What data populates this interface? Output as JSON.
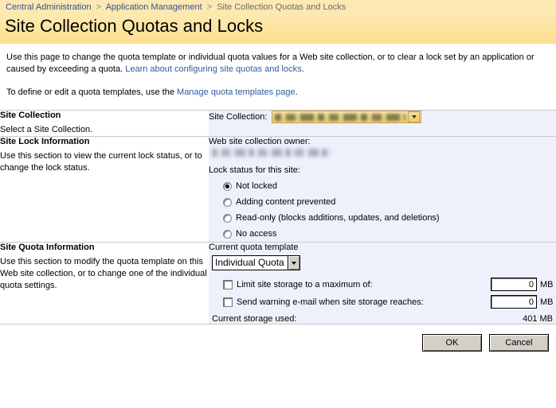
{
  "header": {
    "breadcrumb": [
      {
        "label": "Central Administration",
        "type": "link"
      },
      {
        "label": "Application Management",
        "type": "link"
      },
      {
        "label": "Site Collection Quotas and Locks",
        "type": "current"
      }
    ],
    "separator": ">",
    "title": "Site Collection Quotas and Locks",
    "band_color": "#fde49f"
  },
  "intro": {
    "paragraph1_before": "Use this page to change the quota template or individual quota values for a Web site collection, or to clear a lock set by an application or caused by exceeding a quota. ",
    "paragraph1_link": "Learn about configuring site quotas and locks",
    "paragraph1_after": ".",
    "paragraph2_before": "To define or edit a quota templates, use the ",
    "paragraph2_link": "Manage quota templates page",
    "paragraph2_after": "."
  },
  "sections": {
    "site_collection": {
      "title": "Site Collection",
      "description": "Select a Site Collection.",
      "field_label": "Site Collection:",
      "picker_value": "",
      "picker_redacted": true
    },
    "site_lock": {
      "title": "Site Lock Information",
      "description": "Use this section to view the current lock status, or to change the lock status.",
      "owner_label": "Web site collection owner:",
      "owner_value": "",
      "owner_redacted": true,
      "lock_status_label": "Lock status for this site:",
      "options": [
        {
          "label": "Not locked",
          "selected": true
        },
        {
          "label": "Adding content prevented",
          "selected": false
        },
        {
          "label": "Read-only (blocks additions, updates, and deletions)",
          "selected": false
        },
        {
          "label": "No access",
          "selected": false
        }
      ]
    },
    "site_quota": {
      "title": "Site Quota Information",
      "description": "Use this section to modify the quota template on this Web site collection, or to change one of the individual quota settings.",
      "template_label": "Current quota template",
      "template_value": "Individual Quota",
      "limit_storage_label": "Limit site storage to a maximum of:",
      "limit_storage_checked": false,
      "limit_storage_value": "0",
      "limit_storage_unit": "MB",
      "warning_email_label": "Send warning e-mail when site storage reaches:",
      "warning_email_checked": false,
      "warning_email_value": "0",
      "warning_email_unit": "MB",
      "current_storage_label": "Current storage used:",
      "current_storage_value": "401 MB"
    }
  },
  "footer": {
    "ok_label": "OK",
    "cancel_label": "Cancel"
  }
}
